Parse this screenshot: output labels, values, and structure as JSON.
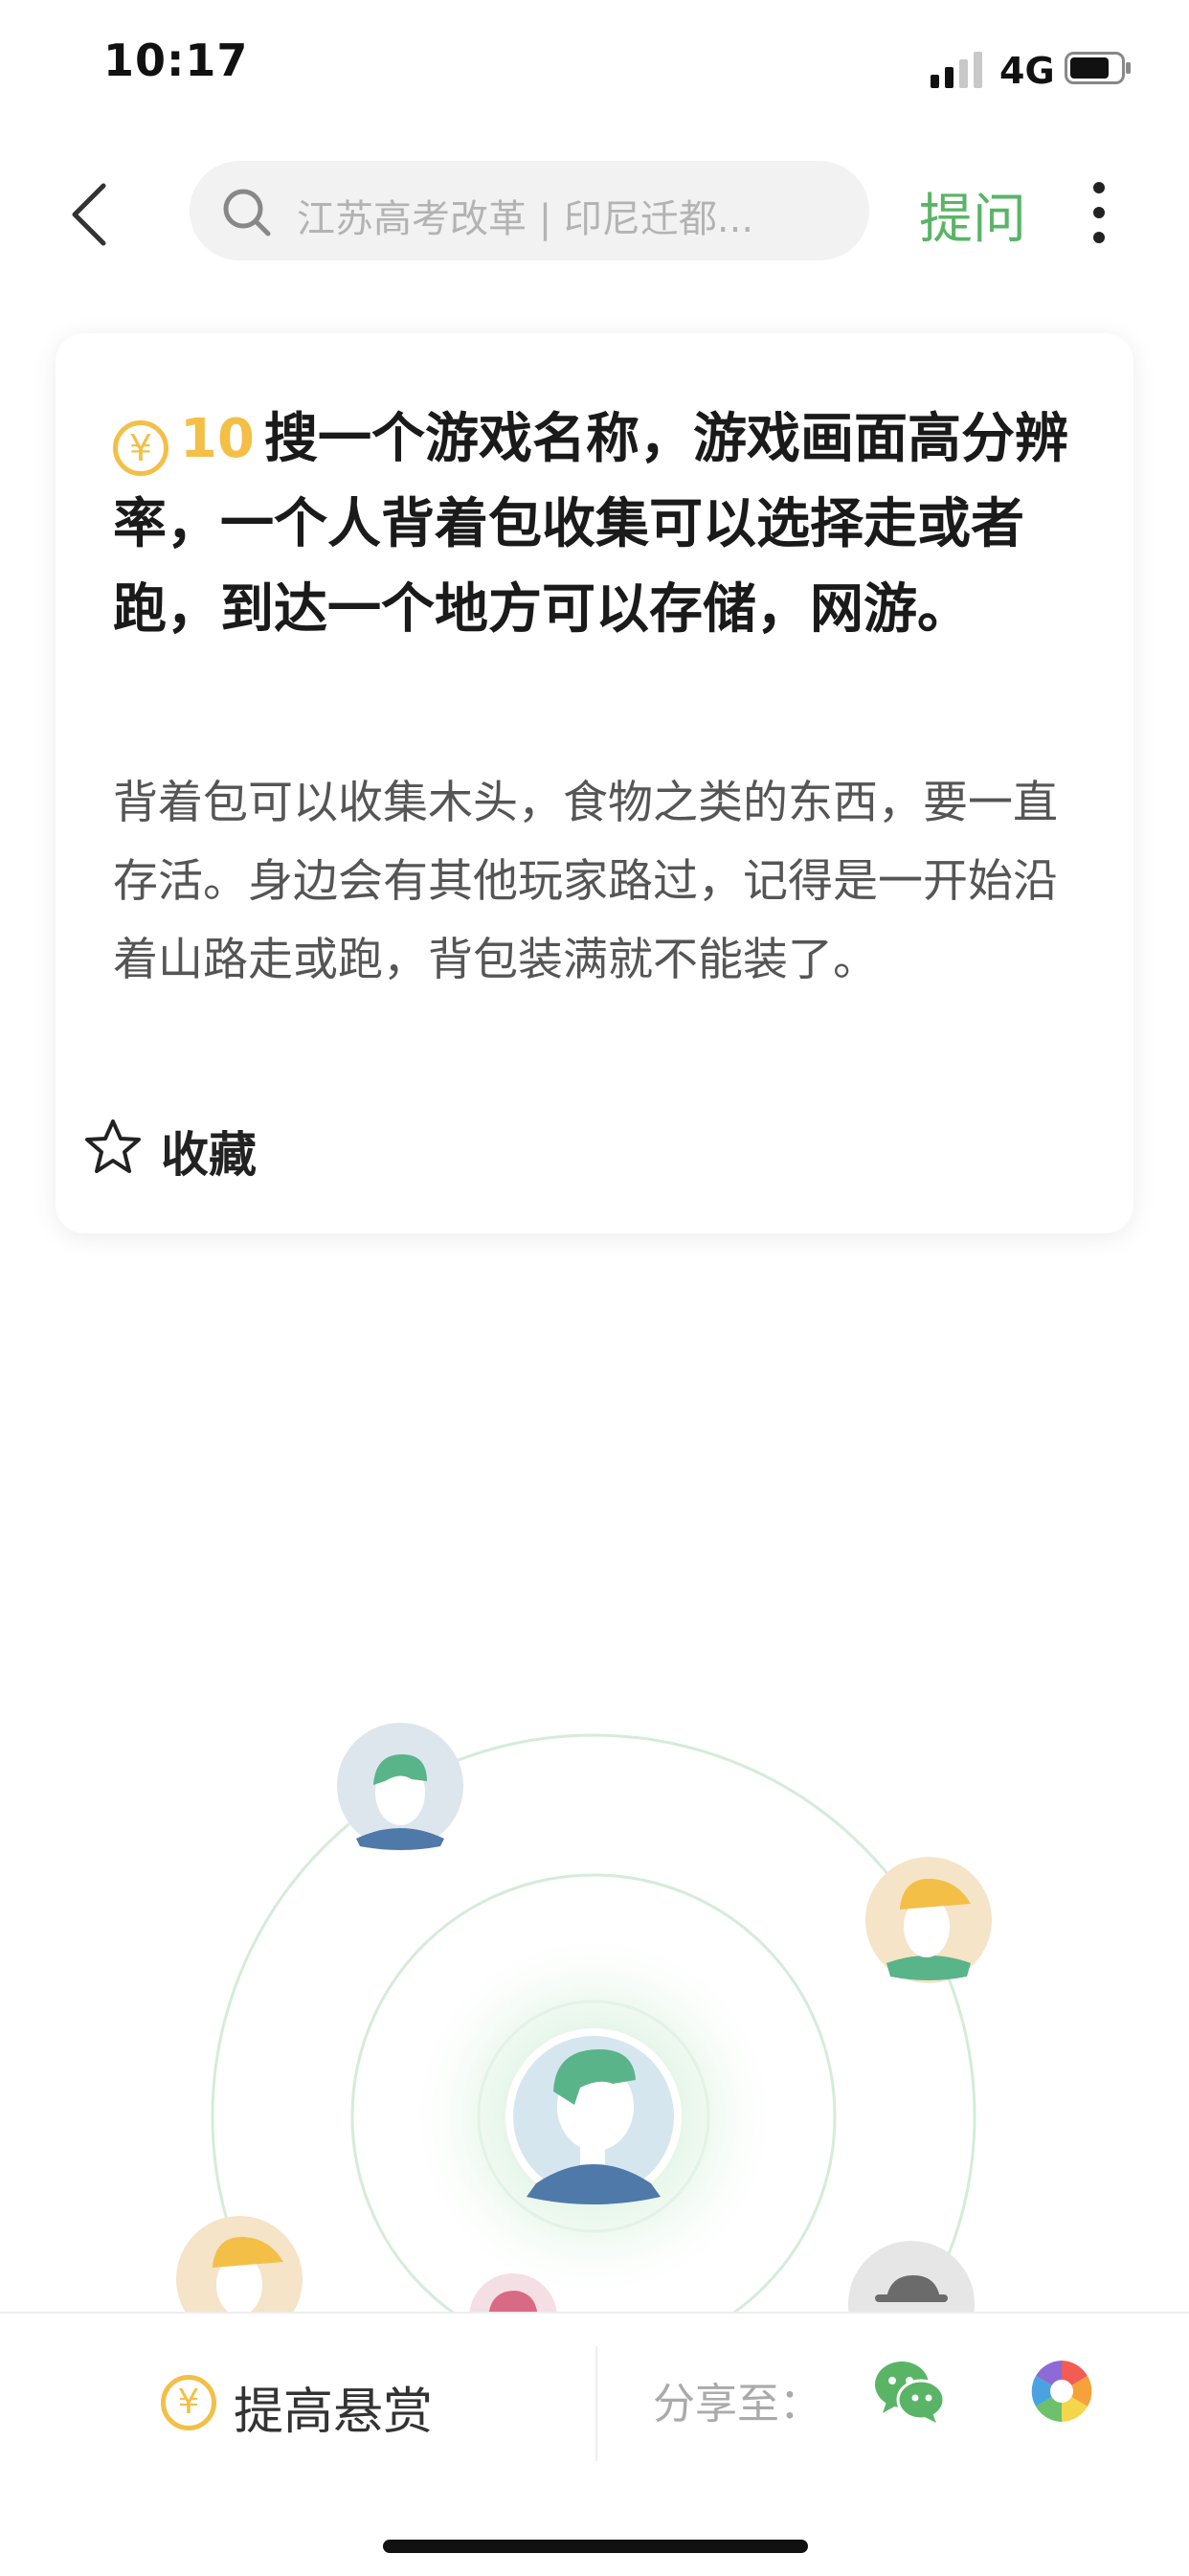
{
  "status_bar": {
    "time": "10:17",
    "network": "4G"
  },
  "nav": {
    "search_placeholder": "江苏高考改革 | 印尼迁都...",
    "ask_label": "提问"
  },
  "question": {
    "coin_symbol": "¥",
    "bounty": "10",
    "title": "搜一个游戏名称，游戏画面高分辨率，一个人背着包收集可以选择走或者跑，到达一个地方可以存储，网游。",
    "description": "背着包可以收集木头，食物之类的东西，要一直存活。身边会有其他玩家路过，记得是一开始沿着山路走或跑，背包装满就不能装了。",
    "favorite_label": "收藏"
  },
  "bottom_bar": {
    "coin_symbol": "¥",
    "raise_reward_label": "提高悬赏",
    "share_label": "分享至："
  },
  "colors": {
    "accent_green": "#5ab466",
    "coin_gold": "#f3bf47"
  }
}
